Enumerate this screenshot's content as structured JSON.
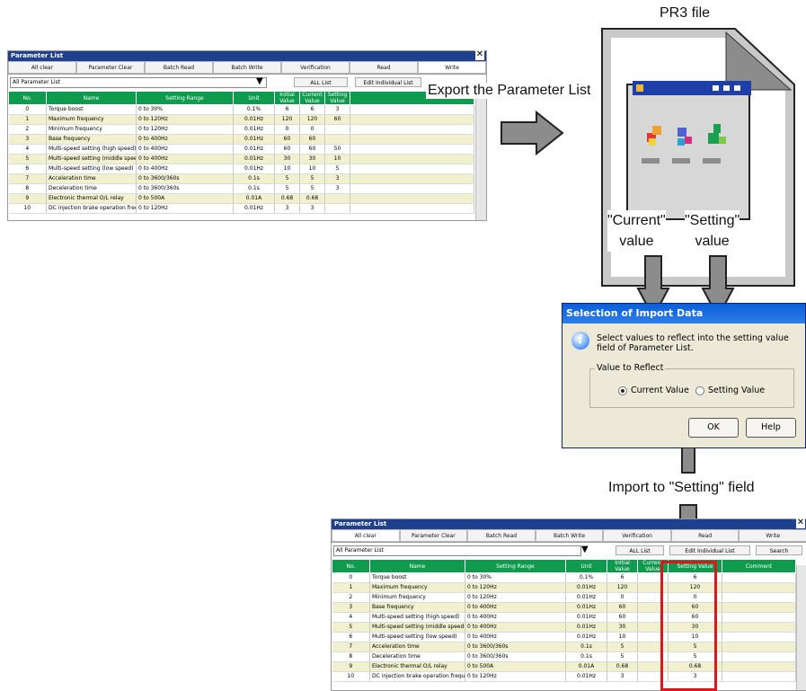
{
  "top_window": {
    "title": "Parameter List",
    "buttons": [
      "All clear",
      "Parameter Clear",
      "Batch Read",
      "Batch Write",
      "Verification",
      "Read",
      "Write"
    ],
    "filter_value": "All Parameter List",
    "all_list_label": "ALL List",
    "edit_individual_label": "Edit Individual List",
    "headers": [
      "No.",
      "Name",
      "Setting Range",
      "Unit",
      "Initial Value",
      "Current Value",
      "Setting Value"
    ],
    "rows": [
      [
        "0",
        "Torque boost",
        "0 to 30%",
        "0.1%",
        "6",
        "6",
        "3"
      ],
      [
        "1",
        "Maximum frequency",
        "0 to 120Hz",
        "0.01Hz",
        "120",
        "120",
        "60"
      ],
      [
        "2",
        "Minimum frequency",
        "0 to 120Hz",
        "0.01Hz",
        "0",
        "0",
        ""
      ],
      [
        "3",
        "Base frequency",
        "0 to 400Hz",
        "0.01Hz",
        "60",
        "60",
        ""
      ],
      [
        "4",
        "Multi-speed setting (high speed)",
        "0 to 400Hz",
        "0.01Hz",
        "60",
        "60",
        "50"
      ],
      [
        "5",
        "Multi-speed setting (middle speed)",
        "0 to 400Hz",
        "0.01Hz",
        "30",
        "30",
        "10"
      ],
      [
        "6",
        "Multi-speed setting (low speed)",
        "0 to 400Hz",
        "0.01Hz",
        "10",
        "10",
        "5"
      ],
      [
        "7",
        "Acceleration time",
        "0 to 3600/360s",
        "0.1s",
        "5",
        "5",
        "3"
      ],
      [
        "8",
        "Deceleration time",
        "0 to 3600/360s",
        "0.1s",
        "5",
        "5",
        "3"
      ],
      [
        "9",
        "Electronic thermal O/L relay",
        "0 to 500A",
        "0.01A",
        "0.68",
        "0.68",
        ""
      ],
      [
        "10",
        "DC injection brake operation frequency",
        "0 to 120Hz",
        "0.01Hz",
        "3",
        "3",
        ""
      ]
    ]
  },
  "labels": {
    "export": "Export the Parameter List",
    "pr3_file": "PR3 file",
    "current_value": "\"Current\"\nvalue",
    "setting_value": "\"Setting\"\nvalue",
    "import_to": "Import to \"Setting\" field"
  },
  "dialog": {
    "title": "Selection of Import Data",
    "message": "Select values to reflect into the setting value field of Parameter List.",
    "group_label": "Value to Reflect",
    "option_current": "Current Value",
    "option_setting": "Setting Value",
    "ok": "OK",
    "help": "Help"
  },
  "bottom_window": {
    "title": "Parameter List",
    "buttons": [
      "All clear",
      "Parameter Clear",
      "Batch Read",
      "Batch Write",
      "Verification",
      "Read",
      "Write"
    ],
    "filter_value": "All Parameter List",
    "all_list_label": "ALL List",
    "edit_individual_label": "Edit Individual List",
    "search_label": "Search",
    "headers": [
      "No.",
      "Name",
      "Setting Range",
      "Unit",
      "Initial Value",
      "Current Value",
      "Setting Value",
      "Comment"
    ],
    "rows": [
      [
        "0",
        "Torque boost",
        "0 to 30%",
        "0.1%",
        "6",
        "",
        "6",
        ""
      ],
      [
        "1",
        "Maximum frequency",
        "0 to 120Hz",
        "0.01Hz",
        "120",
        "",
        "120",
        ""
      ],
      [
        "2",
        "Minimum frequency",
        "0 to 120Hz",
        "0.01Hz",
        "0",
        "",
        "0",
        ""
      ],
      [
        "3",
        "Base frequency",
        "0 to 400Hz",
        "0.01Hz",
        "60",
        "",
        "60",
        ""
      ],
      [
        "4",
        "Multi-speed setting (high speed)",
        "0 to 400Hz",
        "0.01Hz",
        "60",
        "",
        "60",
        ""
      ],
      [
        "5",
        "Multi-speed setting (middle speed)",
        "0 to 400Hz",
        "0.01Hz",
        "30",
        "",
        "30",
        ""
      ],
      [
        "6",
        "Multi-speed setting (low speed)",
        "0 to 400Hz",
        "0.01Hz",
        "10",
        "",
        "10",
        ""
      ],
      [
        "7",
        "Acceleration time",
        "0 to 3600/360s",
        "0.1s",
        "5",
        "",
        "5",
        ""
      ],
      [
        "8",
        "Deceleration time",
        "0 to 3600/360s",
        "0.1s",
        "5",
        "",
        "5",
        ""
      ],
      [
        "9",
        "Electronic thermal O/L relay",
        "0 to 500A",
        "0.01A",
        "0.68",
        "",
        "0.68",
        ""
      ],
      [
        "10",
        "DC injection brake operation frequency",
        "0 to 120Hz",
        "0.01Hz",
        "3",
        "",
        "3",
        ""
      ]
    ]
  },
  "colors": {
    "header_green": "#0f9b4e",
    "row_yellow": "#f1f1cf",
    "title_blue": "#1f3f8f",
    "highlight_red": "#e0141b",
    "arrow_gray": "#8c8c8c"
  }
}
